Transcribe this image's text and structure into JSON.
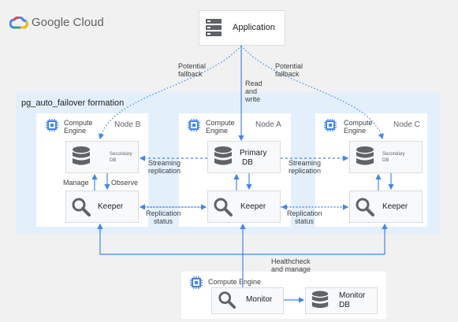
{
  "brand": {
    "name": "Google Cloud"
  },
  "application": {
    "label": "Application"
  },
  "formation": {
    "label": "pg_auto_failover formation"
  },
  "nodes": [
    {
      "id": "b",
      "name": "Node B",
      "engine_line1": "Compute",
      "engine_line2": "Engine",
      "db_line1": "Secondary",
      "db_line2": "DB",
      "keeper": "Keeper"
    },
    {
      "id": "a",
      "name": "Node A",
      "engine_line1": "Compute",
      "engine_line2": "Engine",
      "db_line1": "Primary",
      "db_line2": "DB",
      "keeper": "Keeper"
    },
    {
      "id": "c",
      "name": "Node C",
      "engine_line1": "Compute",
      "engine_line2": "Engine",
      "db_line1": "Secondary",
      "db_line2": "DB",
      "keeper": "Keeper"
    }
  ],
  "edge_labels": {
    "potential_fallback_left": [
      "Potential",
      "fallback"
    ],
    "potential_fallback_right": [
      "Potential",
      "fallback"
    ],
    "read_write": [
      "Read",
      "and",
      "write"
    ],
    "streaming_left": [
      "Streaming",
      "replication"
    ],
    "streaming_right": [
      "Streaming",
      "replication"
    ],
    "replication_status_left": [
      "Replication",
      "status"
    ],
    "replication_status_right": [
      "Replication",
      "status"
    ],
    "manage": "Manage",
    "observe": "Observe",
    "healthcheck": [
      "Healthcheck",
      "and manage"
    ]
  },
  "monitor_node": {
    "engine_label": "Compute Engine",
    "monitor": "Monitor",
    "db_line1": "Monitor",
    "db_line2": "DB"
  },
  "colors": {
    "line": "#4285f4",
    "dotted": "#4a7fd6",
    "icon_dark": "#5f6368",
    "chip": "#4285f4",
    "formation_bg": "#e3f0fc"
  }
}
